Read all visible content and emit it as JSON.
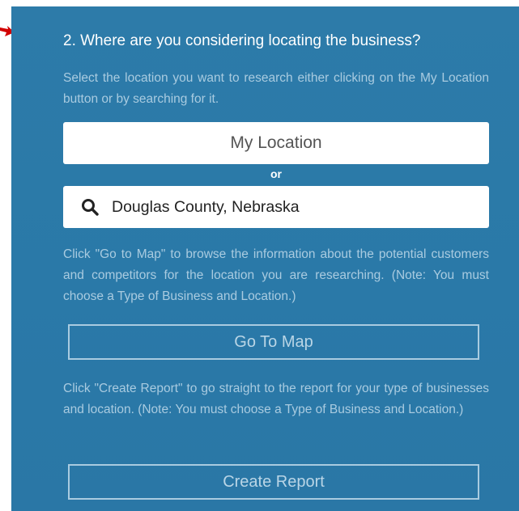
{
  "colors": {
    "panel_bg": "#2a79a8",
    "muted_text": "#a9cbe0",
    "arrow": "#d20000"
  },
  "section": {
    "question": "2. Where are you considering locating the business?",
    "intro": "Select the location you want to research either clicking on the My Location button or by searching for it.",
    "my_location_label": "My Location",
    "or_label": "or",
    "search": {
      "icon": "search-icon",
      "value": "Douglas County, Nebraska"
    },
    "go_to_map_note": "Click \"Go to Map\" to browse the information about the potential customers and competitors for the location you are researching. (Note: You must choose a Type of Business and Location.)",
    "go_to_map_label": "Go To Map",
    "create_report_note": "Click \"Create Report\" to go straight to the report for your type of businesses and location. (Note: You must choose a Type of Business and Location.)",
    "create_report_label": "Create Report"
  }
}
